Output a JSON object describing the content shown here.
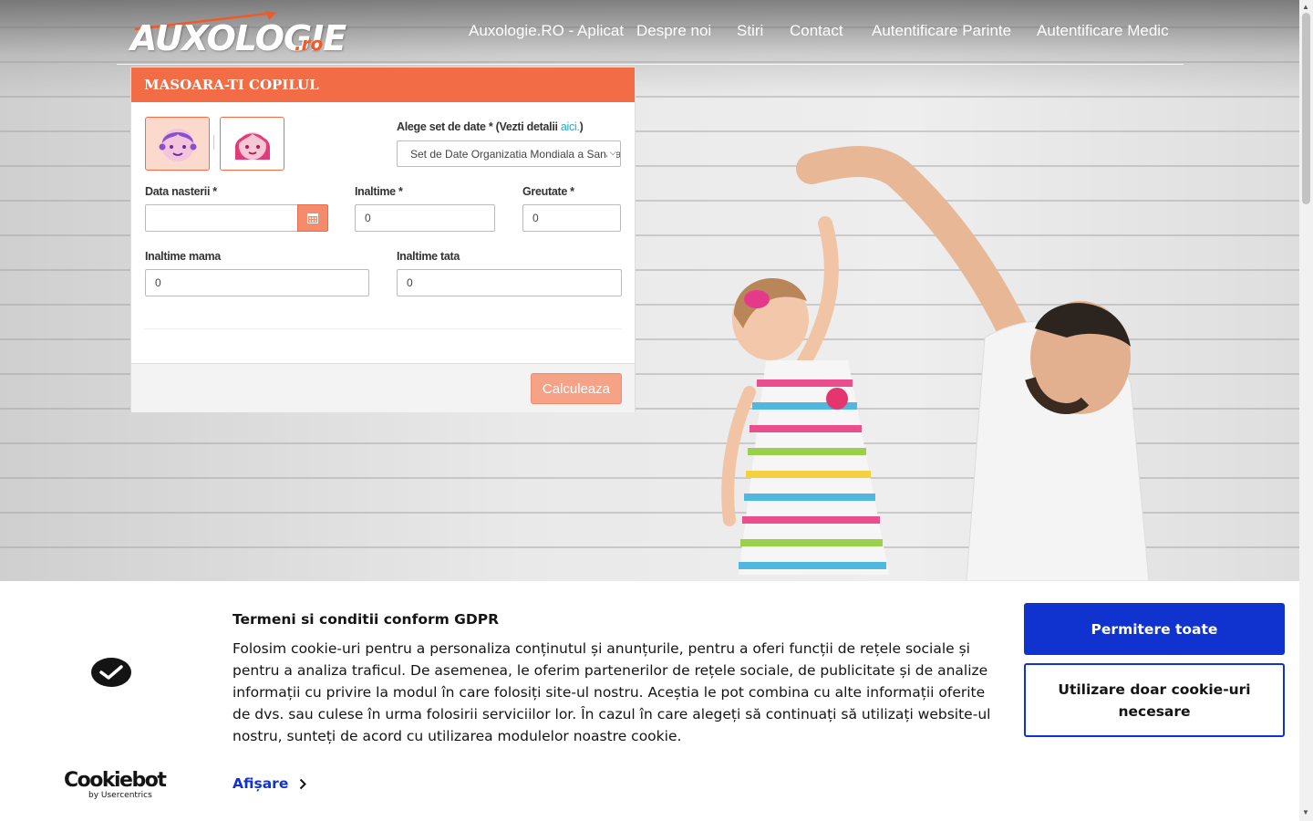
{
  "header": {
    "logo_main": "AUXOLOGIE",
    "logo_suffix": ".ro",
    "nav": [
      {
        "label": "Auxologie.RO - Aplicat"
      },
      {
        "label": "Despre noi"
      },
      {
        "label": "Stiri"
      },
      {
        "label": "Contact"
      },
      {
        "label": "Autentificare Parinte"
      },
      {
        "label": "Autentificare Medic"
      }
    ]
  },
  "form": {
    "title": "MASOARA-TI COPILUL",
    "dataset_label": "Alege set de date * (Vezti detalii ",
    "dataset_link": "aici.",
    "dataset_label_end": ")",
    "dataset_value": "Set de Date Organizatia Mondiala a Sanatatii",
    "birthdate_label": "Data nasterii *",
    "birthdate_value": "",
    "height_label": "Inaltime *",
    "height_value": "0",
    "weight_label": "Greutate *",
    "weight_value": "0",
    "mother_height_label": "Inaltime mama",
    "mother_height_value": "0",
    "father_height_label": "Inaltime tata",
    "father_height_value": "0",
    "submit_label": "Calculeaza",
    "selected_gender": "boy"
  },
  "cookie": {
    "title": "Termeni si conditii conform GDPR",
    "text": "Folosim cookie-uri pentru a personaliza conținutul și anunțurile, pentru a oferi funcții de rețele sociale și pentru a analiza traficul. De asemenea, le oferim partenerilor de rețele sociale, de publicitate și de analize informații cu privire la modul în care folosiți site-ul nostru. Aceștia le pot combina cu alte informații oferite de dvs. sau culese în urma folosirii serviciilor lor. În cazul în care alegeți să continuați să utilizați website-ul nostru, sunteți de acord cu utilizarea modulelor noastre cookie.",
    "show_label": "Afișare",
    "allow_all": "Permitere toate",
    "necessary_only": "Utilizare doar cookie-uri necesare",
    "brand": "Cookiebot",
    "brand_sub": "by Usercentrics"
  },
  "colors": {
    "accent": "#f26d45",
    "cookie_blue": "#1032cf"
  }
}
